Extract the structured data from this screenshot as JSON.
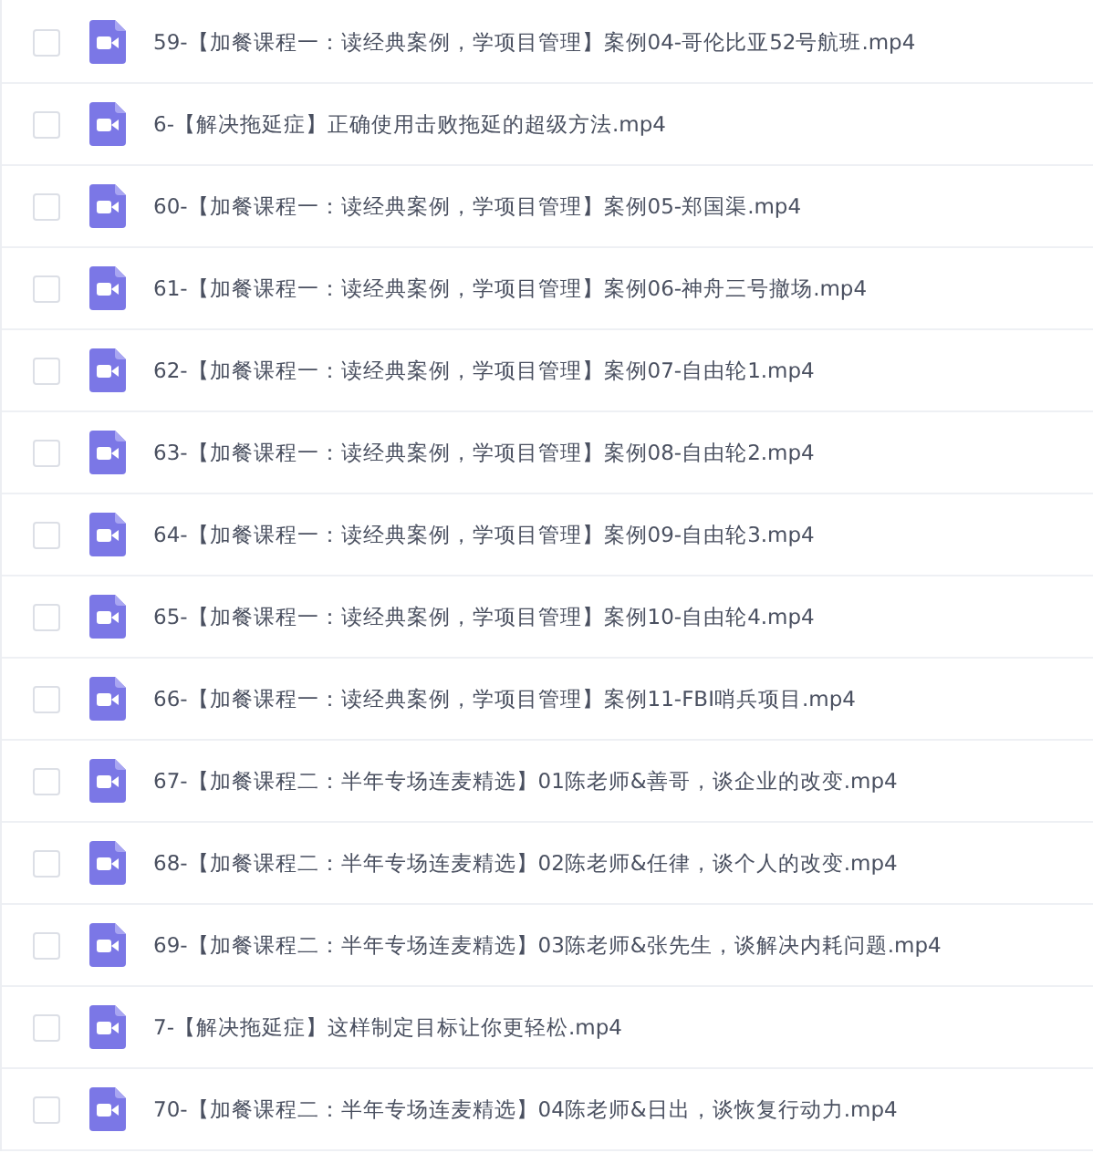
{
  "files": [
    {
      "name": "59-【加餐课程一：读经典案例，学项目管理】案例04-哥伦比亚52号航班.mp4",
      "checked": false
    },
    {
      "name": "6-【解决拖延症】正确使用击败拖延的超级方法.mp4",
      "checked": false
    },
    {
      "name": "60-【加餐课程一：读经典案例，学项目管理】案例05-郑国渠.mp4",
      "checked": false
    },
    {
      "name": "61-【加餐课程一：读经典案例，学项目管理】案例06-神舟三号撤场.mp4",
      "checked": false
    },
    {
      "name": "62-【加餐课程一：读经典案例，学项目管理】案例07-自由轮1.mp4",
      "checked": false
    },
    {
      "name": "63-【加餐课程一：读经典案例，学项目管理】案例08-自由轮2.mp4",
      "checked": false
    },
    {
      "name": "64-【加餐课程一：读经典案例，学项目管理】案例09-自由轮3.mp4",
      "checked": false
    },
    {
      "name": "65-【加餐课程一：读经典案例，学项目管理】案例10-自由轮4.mp4",
      "checked": false
    },
    {
      "name": "66-【加餐课程一：读经典案例，学项目管理】案例11-FBI哨兵项目.mp4",
      "checked": false
    },
    {
      "name": "67-【加餐课程二：半年专场连麦精选】01陈老师&善哥，谈企业的改变.mp4",
      "checked": false
    },
    {
      "name": "68-【加餐课程二：半年专场连麦精选】02陈老师&任律，谈个人的改变.mp4",
      "checked": false
    },
    {
      "name": "69-【加餐课程二：半年专场连麦精选】03陈老师&张先生，谈解决内耗问题.mp4",
      "checked": false
    },
    {
      "name": "7-【解决拖延症】这样制定目标让你更轻松.mp4",
      "checked": false
    },
    {
      "name": "70-【加餐课程二：半年专场连麦精选】04陈老师&日出，谈恢复行动力.mp4",
      "checked": false
    }
  ]
}
